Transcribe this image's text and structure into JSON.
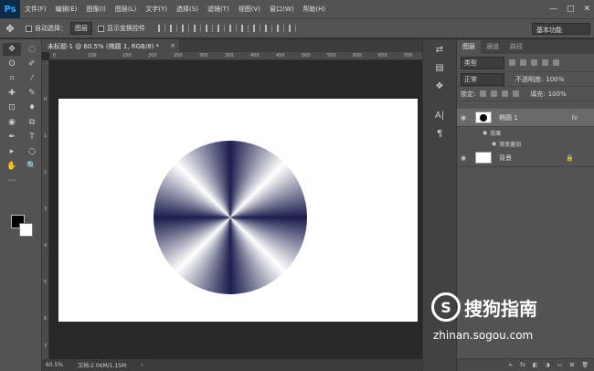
{
  "app": {
    "logo": "Ps"
  },
  "menu": [
    "文件(F)",
    "编辑(E)",
    "图像(I)",
    "图层(L)",
    "文字(Y)",
    "选择(S)",
    "滤镜(T)",
    "视图(V)",
    "窗口(W)",
    "帮助(H)"
  ],
  "window_controls": {
    "minimize": "—",
    "maximize": "□",
    "close": "✕"
  },
  "options": {
    "tool_icon": "move-tool-icon",
    "auto_select_label": "自动选择：",
    "auto_select_value": "图层",
    "show_transform_label": "显示变换控件",
    "workspace": "基本功能"
  },
  "tools": [
    "✥",
    "◌",
    "ʘ",
    "✐",
    "⌗",
    "⁄",
    "✚",
    "✎",
    "⊡",
    "♦",
    "◉",
    "⧉",
    "✒",
    "T",
    "▸",
    "○",
    "✋",
    "🔍",
    "⋯",
    ""
  ],
  "document": {
    "tab_title": "未标题-1 @ 60.5% (椭圆 1, RGB/8) *",
    "close": "×"
  },
  "ruler_h": [
    "0",
    "100",
    "150",
    "200",
    "250",
    "300",
    "350",
    "400",
    "450",
    "500",
    "550",
    "600",
    "650",
    "700"
  ],
  "ruler_v": [
    "0",
    "1",
    "2",
    "3",
    "4",
    "5",
    "6",
    "7"
  ],
  "status": {
    "zoom": "60.5%",
    "doc": "文档:2.06M/1.15M",
    "arrow": "›"
  },
  "panel": {
    "tabs": [
      "图层",
      "通道",
      "路径"
    ],
    "filter_kind": "类型",
    "blend_mode": "正常",
    "opacity_label": "不透明度:",
    "opacity_value": "100%",
    "lock_label": "锁定:",
    "fill_label": "填充:",
    "fill_value": "100%",
    "layers": [
      {
        "name": "椭圆 1",
        "badge": "fx"
      },
      {
        "effects_label": "效果"
      },
      {
        "effect_item": "渐变叠加"
      },
      {
        "name": "背景",
        "badge": "🔒"
      }
    ],
    "footer": [
      "∞",
      "fx",
      "◧",
      "◑",
      "▭",
      "⊞",
      "🗑"
    ]
  },
  "watermark": {
    "title": "搜狗指南",
    "url": "zhinan.sogou.com",
    "logo_letter": "S"
  }
}
